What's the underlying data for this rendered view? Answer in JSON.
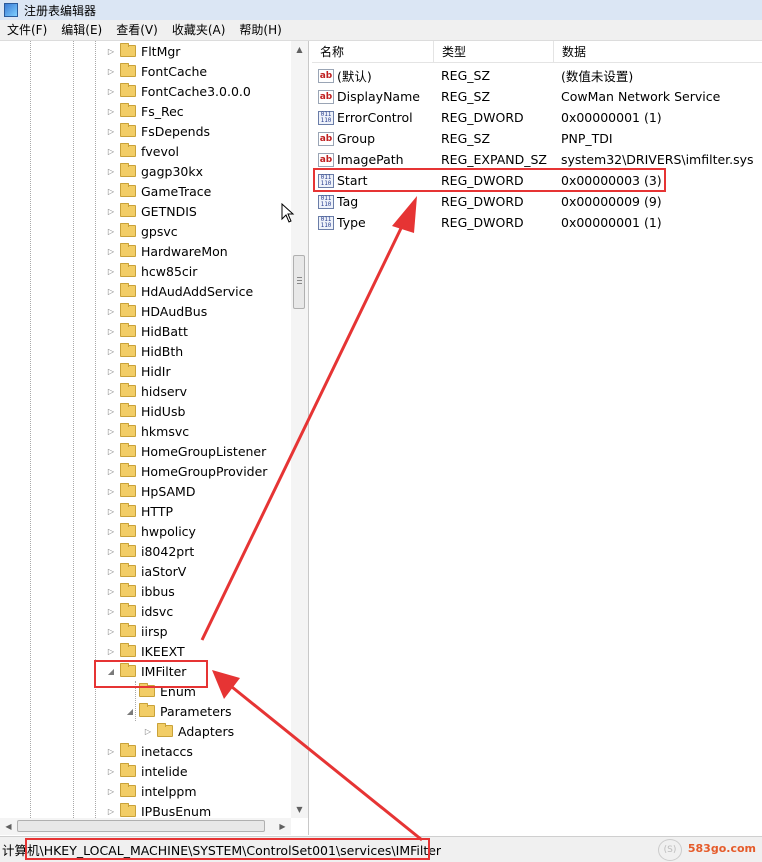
{
  "window": {
    "title": "注册表编辑器"
  },
  "menu": [
    "文件(F)",
    "编辑(E)",
    "查看(V)",
    "收藏夹(A)",
    "帮助(H)"
  ],
  "tree": {
    "items": [
      {
        "label": "FltMgr",
        "level": 0
      },
      {
        "label": "FontCache",
        "level": 0
      },
      {
        "label": "FontCache3.0.0.0",
        "level": 0
      },
      {
        "label": "Fs_Rec",
        "level": 0
      },
      {
        "label": "FsDepends",
        "level": 0
      },
      {
        "label": "fvevol",
        "level": 0
      },
      {
        "label": "gagp30kx",
        "level": 0
      },
      {
        "label": "GameTrace",
        "level": 0
      },
      {
        "label": "GETNDIS",
        "level": 0
      },
      {
        "label": "gpsvc",
        "level": 0
      },
      {
        "label": "HardwareMon",
        "level": 0
      },
      {
        "label": "hcw85cir",
        "level": 0
      },
      {
        "label": "HdAudAddService",
        "level": 0
      },
      {
        "label": "HDAudBus",
        "level": 0
      },
      {
        "label": "HidBatt",
        "level": 0
      },
      {
        "label": "HidBth",
        "level": 0
      },
      {
        "label": "HidIr",
        "level": 0
      },
      {
        "label": "hidserv",
        "level": 0
      },
      {
        "label": "HidUsb",
        "level": 0
      },
      {
        "label": "hkmsvc",
        "level": 0
      },
      {
        "label": "HomeGroupListener",
        "level": 0
      },
      {
        "label": "HomeGroupProvider",
        "level": 0
      },
      {
        "label": "HpSAMD",
        "level": 0
      },
      {
        "label": "HTTP",
        "level": 0
      },
      {
        "label": "hwpolicy",
        "level": 0
      },
      {
        "label": "i8042prt",
        "level": 0
      },
      {
        "label": "iaStorV",
        "level": 0
      },
      {
        "label": "ibbus",
        "level": 0
      },
      {
        "label": "idsvc",
        "level": 0
      },
      {
        "label": "iirsp",
        "level": 0
      },
      {
        "label": "IKEEXT",
        "level": 0
      },
      {
        "label": "IMFilter",
        "level": 0,
        "expanded": true,
        "selected": true
      },
      {
        "label": "Enum",
        "level": 1,
        "leaf": true
      },
      {
        "label": "Parameters",
        "level": 1,
        "expanded": true
      },
      {
        "label": "Adapters",
        "level": 2
      },
      {
        "label": "inetaccs",
        "level": 0
      },
      {
        "label": "intelide",
        "level": 0
      },
      {
        "label": "intelppm",
        "level": 0
      },
      {
        "label": "IPBusEnum",
        "level": 0
      }
    ]
  },
  "values": {
    "columns": [
      "名称",
      "类型",
      "数据"
    ],
    "rows": [
      {
        "icon": "string",
        "name": "(默认)",
        "type": "REG_SZ",
        "data": "(数值未设置)"
      },
      {
        "icon": "string",
        "name": "DisplayName",
        "type": "REG_SZ",
        "data": "CowMan Network Service"
      },
      {
        "icon": "binary",
        "name": "ErrorControl",
        "type": "REG_DWORD",
        "data": "0x00000001 (1)"
      },
      {
        "icon": "string",
        "name": "Group",
        "type": "REG_SZ",
        "data": "PNP_TDI"
      },
      {
        "icon": "string",
        "name": "ImagePath",
        "type": "REG_EXPAND_SZ",
        "data": "system32\\DRIVERS\\imfilter.sys"
      },
      {
        "icon": "binary",
        "name": "Start",
        "type": "REG_DWORD",
        "data": "0x00000003 (3)",
        "highlight": true
      },
      {
        "icon": "binary",
        "name": "Tag",
        "type": "REG_DWORD",
        "data": "0x00000009 (9)"
      },
      {
        "icon": "binary",
        "name": "Type",
        "type": "REG_DWORD",
        "data": "0x00000001 (1)"
      }
    ]
  },
  "icons": {
    "string_value": "ab",
    "binary_value_top": "011",
    "binary_value_bottom": "110"
  },
  "status": {
    "path": "计算机\\HKEY_LOCAL_MACHINE\\SYSTEM\\ControlSet001\\services\\IMFilter"
  },
  "watermark": {
    "text": "583go.com",
    "seal_text": "(S)"
  },
  "colors": {
    "annotation": "#e63434",
    "folder": "#f2cd66",
    "watermark": "#e55b2a"
  }
}
